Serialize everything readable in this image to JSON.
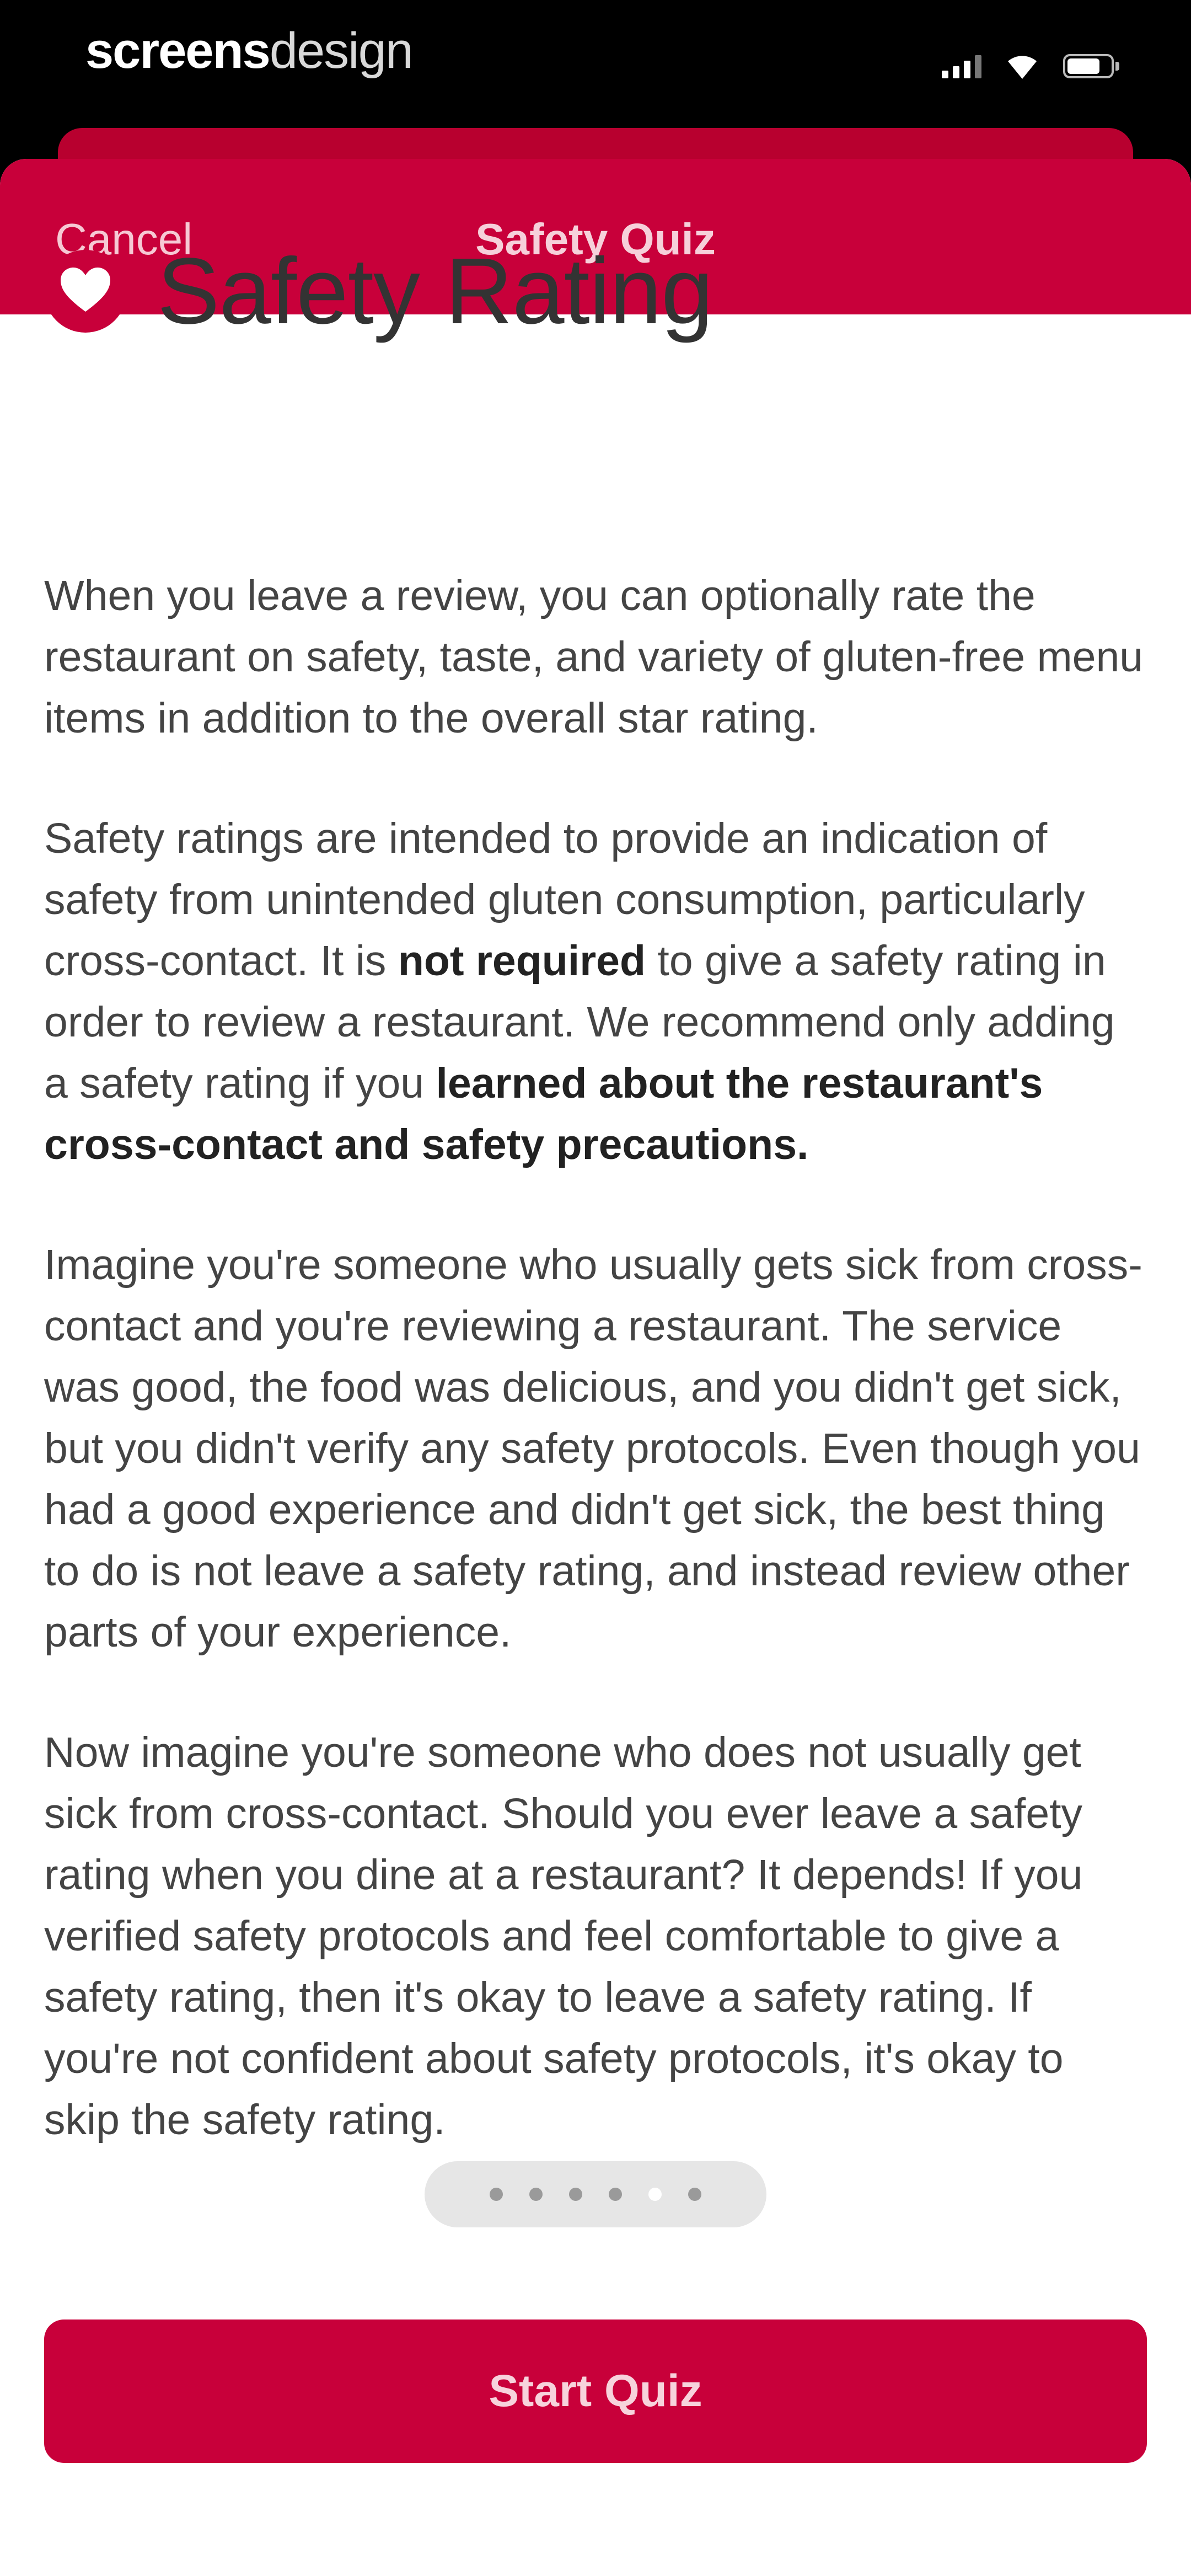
{
  "status_bar": {
    "watermark_bold": "screens",
    "watermark_light": "design",
    "icons": [
      "signal-icon",
      "wifi-icon",
      "battery-icon"
    ]
  },
  "nav": {
    "cancel_label": "Cancel",
    "title": "Safety Quiz"
  },
  "content": {
    "heading_icon": "heart-icon",
    "title": "Safety Rating",
    "paragraphs": [
      {
        "text": "When you leave a review, you can optionally rate the restaurant on safety, taste, and variety of gluten-free menu items in addition to the overall star rating."
      },
      {
        "part1": "Safety ratings are intended to provide an indication of safety from unintended gluten consumption, particularly cross-contact. It is ",
        "bold1": "not required",
        "part2": " to give a safety rating in order to review a restaurant. We recommend only adding a safety rating if you ",
        "bold2": "learned about the restaurant's cross-contact and safety precautions."
      },
      {
        "text": "Imagine you're someone who usually gets sick from cross-contact and you're reviewing a restaurant. The service was good, the food was delicious, and you didn't get sick, but you didn't verify any safety protocols. Even though you had a good experience and didn't get sick, the best thing to do is not leave a safety rating, and instead review other parts of your experience."
      },
      {
        "text": "Now imagine you're someone who does not usually get sick from cross-contact. Should you ever leave a safety rating when you dine at a restaurant? It depends! If you verified safety protocols and feel comfortable to give a safety rating, then it's okay to leave a safety rating. If you're not confident about safety protocols, it's okay to skip the safety rating."
      }
    ]
  },
  "page_indicator": {
    "count": 6,
    "active_index": 4
  },
  "button": {
    "start_label": "Start Quiz"
  },
  "colors": {
    "brand": "#c8003a",
    "text": "#444444"
  }
}
